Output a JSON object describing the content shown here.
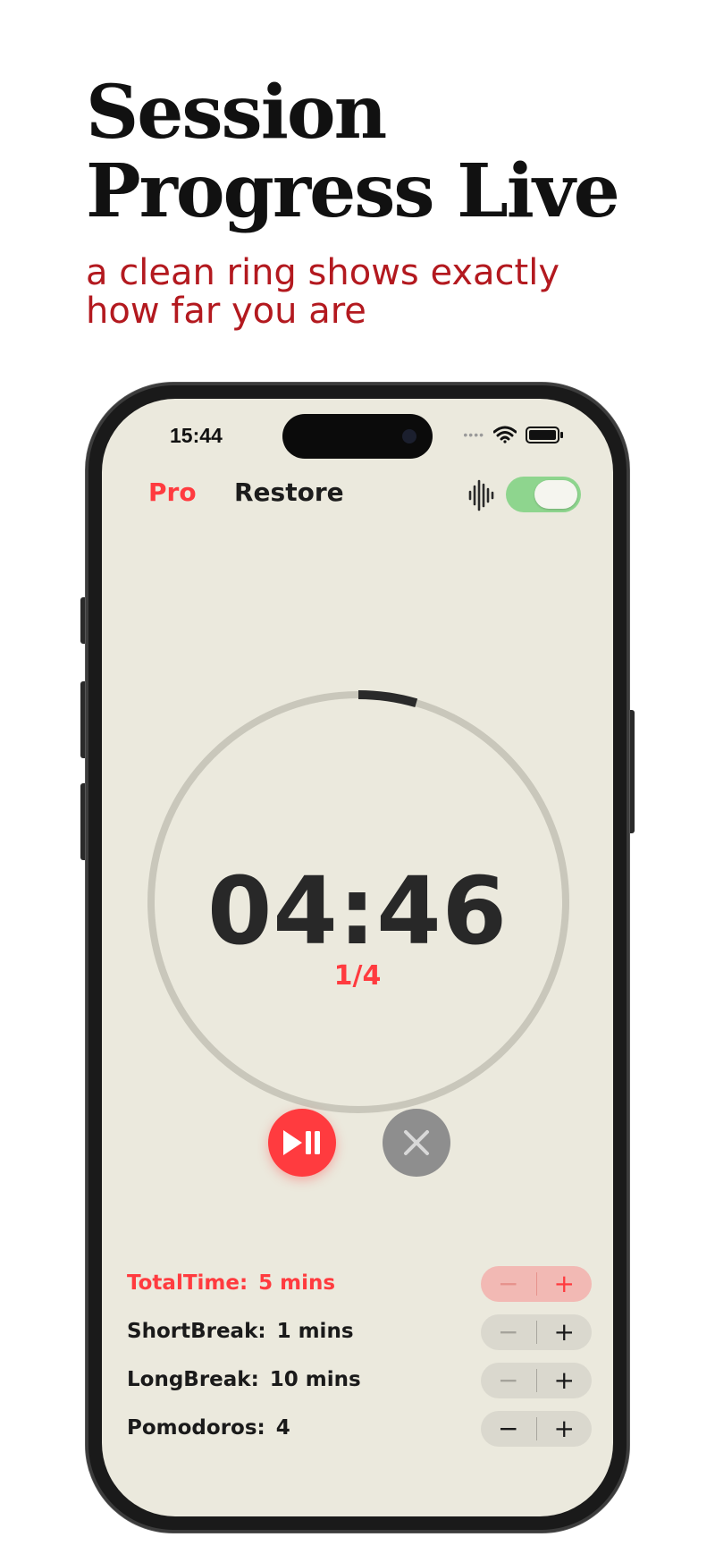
{
  "promo": {
    "title_line1": "Session",
    "title_line2": "Progress Live",
    "subtitle_line1": "a clean ring shows exactly",
    "subtitle_line2": "how far you are"
  },
  "status_bar": {
    "time": "15:44"
  },
  "top_bar": {
    "pro_label": "Pro",
    "restore_label": "Restore",
    "sound_toggle_on": true
  },
  "timer": {
    "display": "04:46",
    "round": "1/4",
    "progress_fraction": 0.045
  },
  "settings": [
    {
      "label": "TotalTime:",
      "value": "5 mins"
    },
    {
      "label": "ShortBreak:",
      "value": "1 mins"
    },
    {
      "label": "LongBreak:",
      "value": "10 mins"
    },
    {
      "label": "Pomodoros:",
      "value": "4"
    }
  ],
  "stepper_symbols": {
    "minus": "−",
    "plus": "+"
  },
  "colors": {
    "accent": "#ff3b3f",
    "screen_bg": "#ebe9dd",
    "ring_track": "#c9c7bb",
    "ring_progress": "#2a2a2a",
    "toggle_on": "#8ed58e",
    "subtitle": "#b3191f"
  }
}
